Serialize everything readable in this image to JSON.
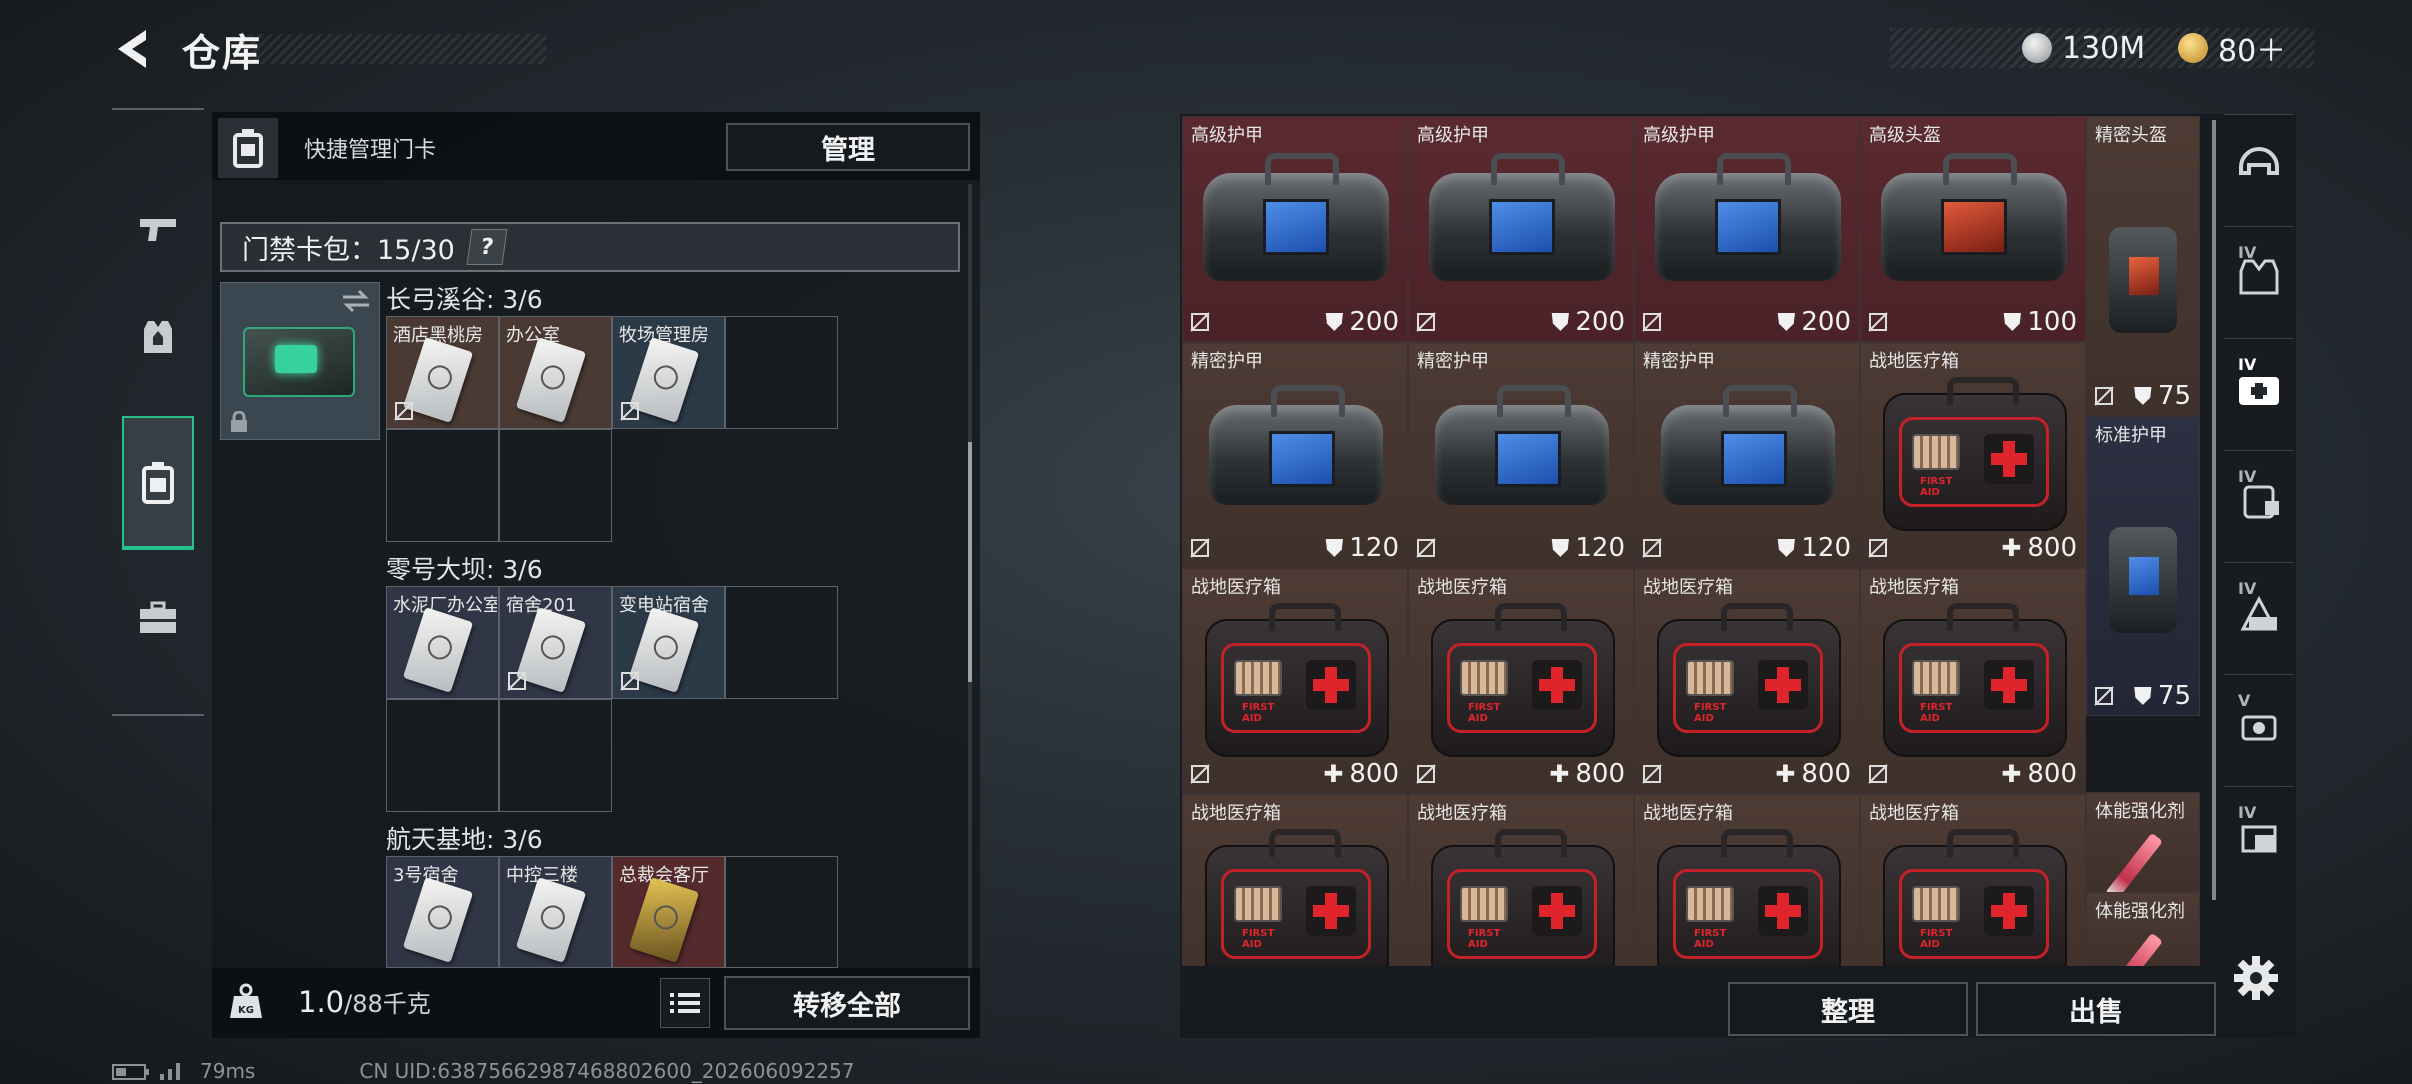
{
  "header": {
    "title": "仓库",
    "currencies": [
      {
        "icon": "silver-coin-icon",
        "value": "130M"
      },
      {
        "icon": "gold-triangle-coin-icon",
        "value": "80＋"
      }
    ]
  },
  "sidebar": {
    "tabs": [
      {
        "name": "weapons-tab",
        "icon": "pistol-icon"
      },
      {
        "name": "gear-tab",
        "icon": "vest-icon"
      },
      {
        "name": "keycards-tab",
        "icon": "keycard-holder-icon",
        "active": true
      },
      {
        "name": "toolbox-tab",
        "icon": "briefcase-icon"
      }
    ]
  },
  "left_panel": {
    "quick_manage_label": "快捷管理门卡",
    "manage_button": "管理",
    "card_pack_label": "门禁卡包：15/30",
    "card_pack_help": "?",
    "maps": [
      {
        "title": "长弓溪谷: 3/6",
        "cards": [
          {
            "label": "酒店黑桃房",
            "style": "brown"
          },
          {
            "label": "办公室",
            "style": "brown"
          },
          {
            "label": "牧场管理房",
            "style": "navy"
          }
        ]
      },
      {
        "title": "零号大坝: 3/6",
        "cards": [
          {
            "label": "水泥厂办公室",
            "style": "navy"
          },
          {
            "label": "宿舍201",
            "style": "navy"
          },
          {
            "label": "变电站宿舍",
            "style": "navy"
          }
        ]
      },
      {
        "title": "航天基地: 3/6",
        "cards": [
          {
            "label": "3号宿舍",
            "style": "navy"
          },
          {
            "label": "中控三楼",
            "style": "navy"
          },
          {
            "label": "总裁会客厅",
            "style": "red"
          }
        ]
      }
    ],
    "weight_value": "1.0",
    "weight_unit": "/88千克",
    "transfer_all_button": "转移全部"
  },
  "status_bar": {
    "ping": "79ms",
    "uid": "CN UID:6387566298746880260​0_202606092257"
  },
  "inventory": {
    "items": [
      {
        "name": "高级护甲",
        "type": "armor",
        "value": "200",
        "glyph": "shield",
        "bg": "red"
      },
      {
        "name": "高级护甲",
        "type": "armor",
        "value": "200",
        "glyph": "shield",
        "bg": "red"
      },
      {
        "name": "高级护甲",
        "type": "armor",
        "value": "200",
        "glyph": "shield",
        "bg": "red"
      },
      {
        "name": "高级头盔",
        "type": "helmet",
        "value": "100",
        "glyph": "shield",
        "bg": "red"
      },
      {
        "name": "精密护甲",
        "type": "armor-small",
        "value": "120",
        "glyph": "shield",
        "bg": "brown"
      },
      {
        "name": "精密护甲",
        "type": "armor-small",
        "value": "120",
        "glyph": "shield",
        "bg": "brown"
      },
      {
        "name": "精密护甲",
        "type": "armor-small",
        "value": "120",
        "glyph": "shield",
        "bg": "brown"
      },
      {
        "name": "战地医疗箱",
        "type": "medkit",
        "value": "800",
        "glyph": "plus",
        "bg": "brown"
      },
      {
        "name": "战地医疗箱",
        "type": "medkit",
        "value": "800",
        "glyph": "plus",
        "bg": "brown"
      },
      {
        "name": "战地医疗箱",
        "type": "medkit",
        "value": "800",
        "glyph": "plus",
        "bg": "brown"
      },
      {
        "name": "战地医疗箱",
        "type": "medkit",
        "value": "800",
        "glyph": "plus",
        "bg": "brown"
      },
      {
        "name": "战地医疗箱",
        "type": "medkit",
        "value": "800",
        "glyph": "plus",
        "bg": "brown"
      },
      {
        "name": "战地医疗箱",
        "type": "medkit",
        "value": "",
        "glyph": "",
        "bg": "brown"
      },
      {
        "name": "战地医疗箱",
        "type": "medkit",
        "value": "",
        "glyph": "",
        "bg": "brown"
      },
      {
        "name": "战地医疗箱",
        "type": "medkit",
        "value": "",
        "glyph": "",
        "bg": "brown"
      },
      {
        "name": "战地医疗箱",
        "type": "medkit",
        "value": "",
        "glyph": "",
        "bg": "brown"
      }
    ],
    "side_items": [
      {
        "name": "精密头盔",
        "type": "helmet-small",
        "value": "75",
        "bg": "brown"
      },
      {
        "name": "标准护甲",
        "type": "vest-small",
        "value": "75",
        "bg": "navy"
      },
      {
        "name": "体能强化剂",
        "type": "syringe",
        "value": "",
        "bg": "brown"
      },
      {
        "name": "体能强化剂",
        "type": "syringe",
        "value": "",
        "bg": "brown"
      }
    ],
    "sort_button": "整理",
    "sell_button": "出售"
  },
  "category_rail": {
    "tabs": [
      {
        "icon": "helmet-icon",
        "level": ""
      },
      {
        "icon": "vest-icon",
        "level": "IV"
      },
      {
        "icon": "medkit-icon",
        "level": "IV",
        "active": true
      },
      {
        "icon": "backpack-icon",
        "level": "IV"
      },
      {
        "icon": "rig-icon",
        "level": "IV"
      },
      {
        "icon": "armor-plate-icon",
        "level": "V"
      },
      {
        "icon": "container-icon",
        "level": "IV"
      }
    ]
  },
  "colors": {
    "accent_green": "#24c089",
    "red_rarity": "#5a2a30",
    "brown_rarity": "#4d3b34",
    "navy_rarity": "#2d3042"
  }
}
